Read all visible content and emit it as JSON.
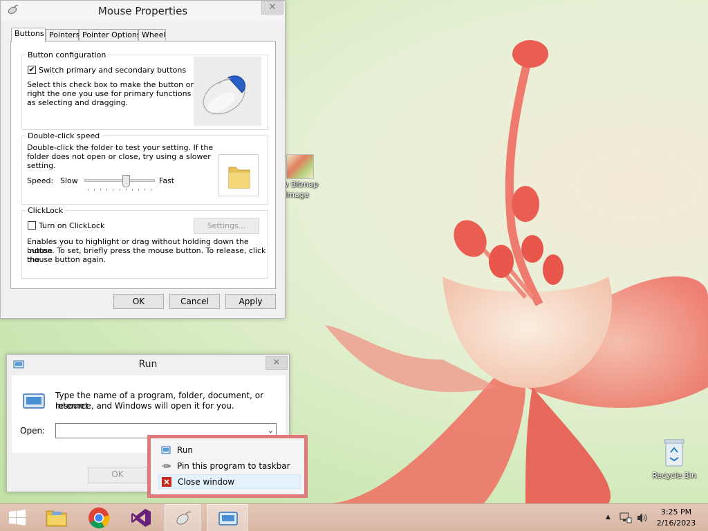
{
  "mouse_properties": {
    "title": "Mouse Properties",
    "close_glyph": "✕",
    "tabs": [
      {
        "label": "Buttons"
      },
      {
        "label": "Pointers"
      },
      {
        "label": "Pointer Options"
      },
      {
        "label": "Wheel"
      }
    ],
    "button_config": {
      "legend": "Button configuration",
      "switch_label": "Switch primary and secondary buttons",
      "switch_checked": true,
      "check_glyph": "✔",
      "desc_line1": "Select this check box to make the button on the",
      "desc_line2": "right the one you use for primary functions such",
      "desc_line3": "as selecting and dragging."
    },
    "double_click": {
      "legend": "Double-click speed",
      "desc_line1": "Double-click the folder to test your setting. If the",
      "desc_line2": "folder does not open or close, try using a slower",
      "desc_line3": "setting.",
      "speed_label": "Speed:",
      "slow_label": "Slow",
      "fast_label": "Fast",
      "slider_value": 0.6
    },
    "clicklock": {
      "legend": "ClickLock",
      "turn_on_label": "Turn on ClickLock",
      "turn_on_checked": false,
      "settings_label": "Settings...",
      "desc_line1": "Enables you to highlight or drag without holding down the mouse",
      "desc_line2": "button. To set, briefly press the mouse button. To release, click the",
      "desc_line3": "mouse button again."
    },
    "ok_label": "OK",
    "cancel_label": "Cancel",
    "apply_label": "Apply"
  },
  "run_dialog": {
    "title": "Run",
    "close_glyph": "✕",
    "desc_line1": "Type the name of a program, folder, document, or Internet",
    "desc_line2": "resource, and Windows will open it for you.",
    "open_label": "Open:",
    "open_value": "",
    "ok_label": "OK"
  },
  "jump_menu": {
    "items": [
      {
        "label": "Run",
        "icon": "run-icon"
      },
      {
        "label": "Pin this program to taskbar",
        "icon": "pin-icon"
      },
      {
        "label": "Close window",
        "icon": "close-icon"
      }
    ]
  },
  "desktop": {
    "bitmap_line1": "w Bitmap",
    "bitmap_line2": "Image",
    "recycle_bin": "Recycle Bin"
  },
  "taskbar": {
    "apps": [
      {
        "name": "start",
        "icon": "windows-logo-icon"
      },
      {
        "name": "file-explorer",
        "icon": "folder-icon"
      },
      {
        "name": "chrome",
        "icon": "chrome-icon"
      },
      {
        "name": "visual-studio",
        "icon": "visual-studio-icon"
      },
      {
        "name": "mouse-properties",
        "icon": "mouse-icon"
      },
      {
        "name": "run",
        "icon": "run-icon"
      }
    ],
    "tray_arrow": "▲",
    "time": "3:25 PM",
    "date": "2/16/2023"
  },
  "colors": {
    "menu_highlight_border": "#e07a7a",
    "visual_studio_purple": "#68217a",
    "close_red": "#c42b1c"
  }
}
